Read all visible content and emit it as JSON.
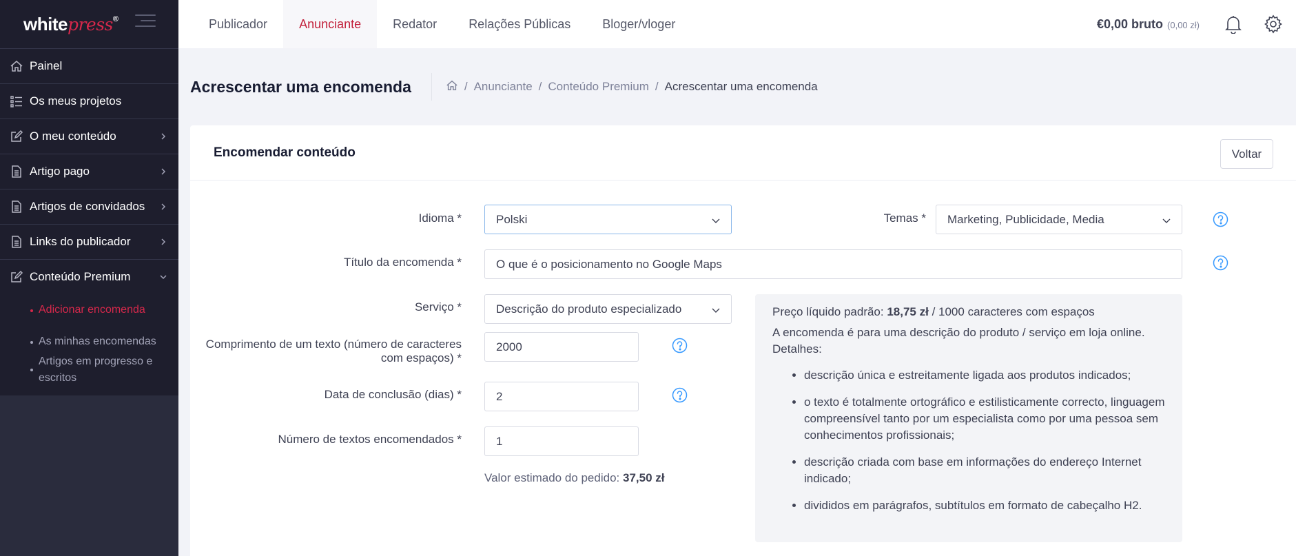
{
  "brand": {
    "word": "white",
    "script": "press",
    "mark": "®"
  },
  "sidebar": {
    "items": [
      {
        "label": "Painel",
        "icon": "home-icon"
      },
      {
        "label": "Os meus projetos",
        "icon": "list-icon"
      },
      {
        "label": "O meu conteúdo",
        "icon": "edit-icon"
      },
      {
        "label": "Artigo pago",
        "icon": "document-icon"
      },
      {
        "label": "Artigos de convidados",
        "icon": "document-icon"
      },
      {
        "label": "Links do publicador",
        "icon": "document-icon"
      },
      {
        "label": "Conteúdo Premium",
        "icon": "edit-icon"
      }
    ],
    "subitems": [
      {
        "label": "Adicionar encomenda"
      },
      {
        "label": "As minhas encomendas"
      },
      {
        "label": "Artigos em progresso e escritos"
      }
    ]
  },
  "topbar": {
    "tabs": [
      {
        "label": "Publicador"
      },
      {
        "label": "Anunciante"
      },
      {
        "label": "Redator"
      },
      {
        "label": "Relações Públicas"
      },
      {
        "label": "Bloger/vloger"
      }
    ],
    "balance": "€0,00 bruto",
    "balance_small": "(0,00 zł)"
  },
  "subheader": {
    "title": "Acrescentar uma encomenda",
    "breadcrumbs": [
      "Anunciante",
      "Conteúdo Premium",
      "Acrescentar uma encomenda"
    ]
  },
  "card": {
    "title": "Encomendar conteúdo",
    "back_label": "Voltar"
  },
  "form": {
    "language_label": "Idioma *",
    "language_value": "Polski",
    "topics_label": "Temas *",
    "topics_value": "Marketing, Publicidade, Media",
    "title_label": "Título da encomenda *",
    "title_value": "O que é o posicionamento no Google Maps",
    "service_label": "Serviço *",
    "service_value": "Descrição do produto especializado",
    "length_label_1": "Comprimento de um texto (número de caracteres",
    "length_label_2": "com espaços) *",
    "length_value": "2000",
    "deadline_label": "Data de conclusão (dias) *",
    "deadline_value": "2",
    "count_label": "Número de textos encomendados *",
    "count_value": "1",
    "estimate_label": "Valor estimado do pedido:",
    "estimate_value": "37,50 zł"
  },
  "info": {
    "price_prefix": "Preço líquido padrão:",
    "price_value": "18,75 zł",
    "price_suffix": "/ 1000 caracteres com espaços",
    "desc": "A encomenda é para uma descrição do produto / serviço em loja online.",
    "details": "Detalhes:",
    "bullets": [
      "descrição única e estreitamente ligada aos produtos indicados;",
      "o texto é totalmente ortográfico e estilisticamente correcto, linguagem compreensível tanto por um especialista como por uma pessoa sem conhecimentos profissionais;",
      "descrição criada com base em informações do endereço Internet indicado;",
      "divididos em parágrafos, subtítulos em formato de cabeçalho H2."
    ]
  },
  "colors": {
    "accent": "#d6284b",
    "sidebar": "#1e1e2d",
    "help": "#3699ff"
  }
}
